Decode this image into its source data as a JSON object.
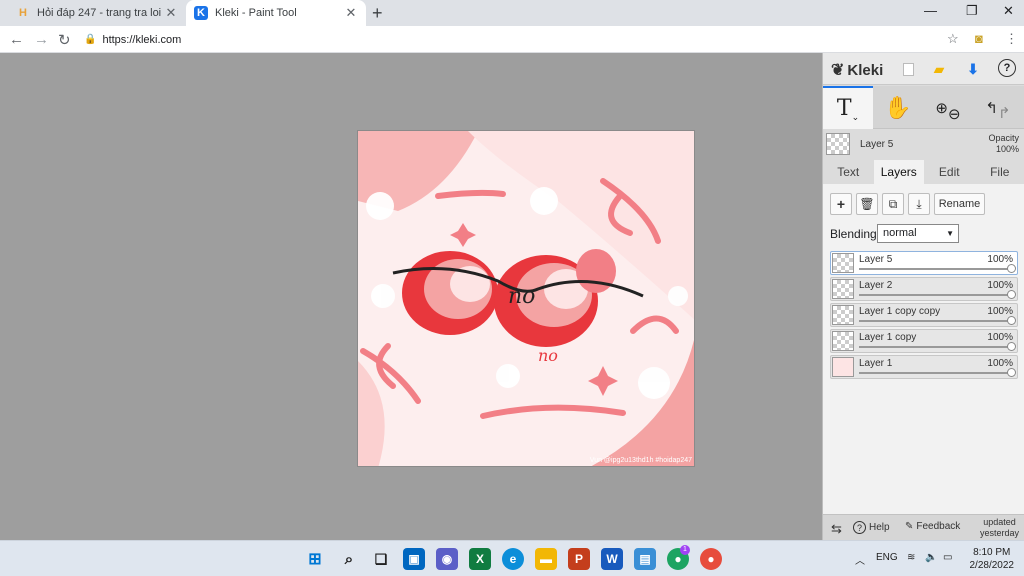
{
  "browser": {
    "tabs": [
      {
        "title": "Hỏi đáp 247 - trang tra loi",
        "favicon": "H"
      },
      {
        "title": "Kleki - Paint Tool",
        "favicon": "K"
      }
    ],
    "url": "https://kleki.com"
  },
  "canvas": {
    "lettering": "no",
    "watermark": "Vun @ipg2u13thd1h #hoidap247"
  },
  "panel": {
    "brand": "Kleki",
    "current_layer": "Layer 5",
    "opacity_label": "Opacity",
    "opacity_value": "100%",
    "tabs": [
      "Text",
      "Layers",
      "Edit",
      "File"
    ],
    "rename_label": "Rename",
    "blending_label": "Blending",
    "blending_value": "normal",
    "layers": [
      {
        "name": "Layer 5",
        "opacity": "100%",
        "selected": true
      },
      {
        "name": "Layer 2",
        "opacity": "100%",
        "selected": false
      },
      {
        "name": "Layer 1 copy copy",
        "opacity": "100%",
        "selected": false
      },
      {
        "name": "Layer 1 copy",
        "opacity": "100%",
        "selected": false
      },
      {
        "name": "Layer 1",
        "opacity": "100%",
        "selected": false
      }
    ],
    "bottom": {
      "help": "Help",
      "feedback": "Feedback",
      "updated_line1": "updated",
      "updated_line2": "yesterday"
    }
  },
  "taskbar": {
    "lang": "ENG",
    "time": "8:10 PM",
    "date": "2/28/2022",
    "badge": "1"
  }
}
